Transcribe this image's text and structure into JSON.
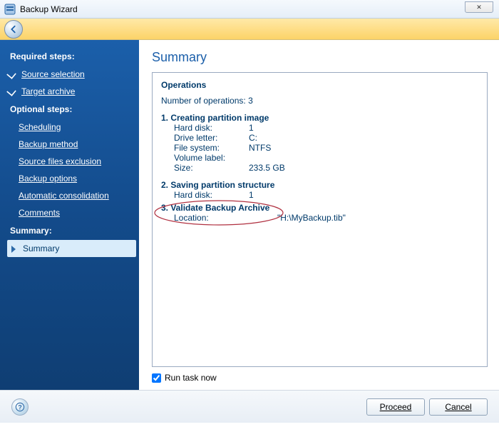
{
  "window": {
    "title": "Backup Wizard",
    "close_label": "✕"
  },
  "sidebar": {
    "required_heading": "Required steps:",
    "optional_heading": "Optional steps:",
    "summary_heading": "Summary:",
    "required": [
      {
        "label": "Source selection"
      },
      {
        "label": "Target archive"
      }
    ],
    "optional": [
      {
        "label": "Scheduling"
      },
      {
        "label": "Backup method"
      },
      {
        "label": "Source files exclusion"
      },
      {
        "label": "Backup options"
      },
      {
        "label": "Automatic consolidation"
      },
      {
        "label": "Comments"
      }
    ],
    "summary_item": "Summary"
  },
  "content": {
    "title": "Summary",
    "operations_label": "Operations",
    "operation_count_label": "Number of operations: 3",
    "step1": {
      "title": "1. Creating partition image",
      "hard_disk_k": "Hard disk:",
      "hard_disk_v": "1",
      "drive_k": "Drive letter:",
      "drive_v": "C:",
      "fs_k": "File system:",
      "fs_v": "NTFS",
      "vol_k": "Volume label:",
      "vol_v": "",
      "size_k": "Size:",
      "size_v": "233.5 GB"
    },
    "step2": {
      "title": "2. Saving partition structure",
      "hard_disk_k": "Hard disk:",
      "hard_disk_v": "1"
    },
    "step3": {
      "title": "3. Validate Backup Archive",
      "loc_k": "Location:",
      "loc_v": "\"H:\\MyBackup.tib\""
    },
    "run_task_label": "Run task now"
  },
  "footer": {
    "proceed": "Proceed",
    "cancel": "Cancel"
  }
}
